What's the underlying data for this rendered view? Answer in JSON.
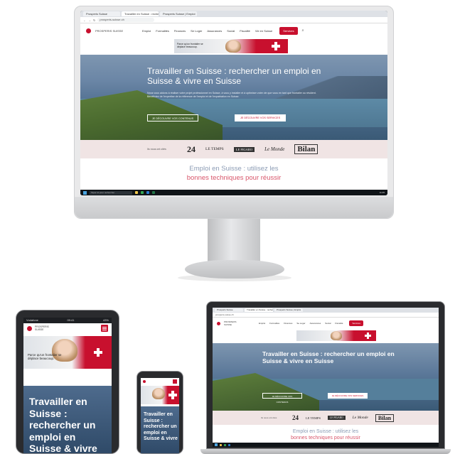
{
  "site": {
    "tabs": [
      "Prosperis Suisse",
      "Travailler en Suisse : rechercher",
      "Prosperis Suisse | Emploi"
    ],
    "url": "prosperis-suisse.ch",
    "logo_text": "PROSPERIS SUISSE",
    "menu": [
      "Emploi",
      "Formalités",
      "Finances",
      "Se Loger",
      "Assurances",
      "Social",
      "Fiscalité",
      "Vie en Suisse"
    ],
    "services_button": "Services",
    "ad_text": "Parce qu'un frontalier se déplace beaucoup.",
    "hero_title": "Travailler en Suisse : rechercher un emploi en Suisse & vivre en Suisse",
    "hero_body": "Nous vous aidons à réaliser votre projet professionnel en Suisse, à vous y installer et à optimiser votre vie que vous en tant que frontalier ou résident. Bénéficiez de l'expertise de la référence de l'emploi et de l'expatriation en Suisse.",
    "btn_content": "JE DÉCOUVRE VOS CONTENUS",
    "btn_services": "JE DÉCOUVRE VOS SERVICES",
    "press_label": "Ils nous ont cités",
    "press_logos": [
      "24",
      "LE TEMPS",
      "LE FIGARO",
      "Le Monde",
      "Bilan"
    ],
    "section_line1": "Emploi en Suisse : utilisez les",
    "section_line2": "bonnes techniques pour réussir"
  },
  "taskbar": {
    "search_placeholder": "Taper ici pour rechercher",
    "clock": "11:05"
  },
  "tablet": {
    "status_left": "Vodafone",
    "status_center": "09:41",
    "status_right": "43%",
    "hero_title": "Travailler en Suisse : rechercher un emploi en Suisse & vivre"
  },
  "phone": {
    "hero_title": "Travailler en Suisse : rechercher un emploi en Suisse & vivre"
  },
  "colors": {
    "brand_red": "#c8102e",
    "hero_blue": "#4f6e8f",
    "press_band": "#f0e4e4",
    "section_blue": "#8b9bb4",
    "section_pink": "#d8556a"
  }
}
